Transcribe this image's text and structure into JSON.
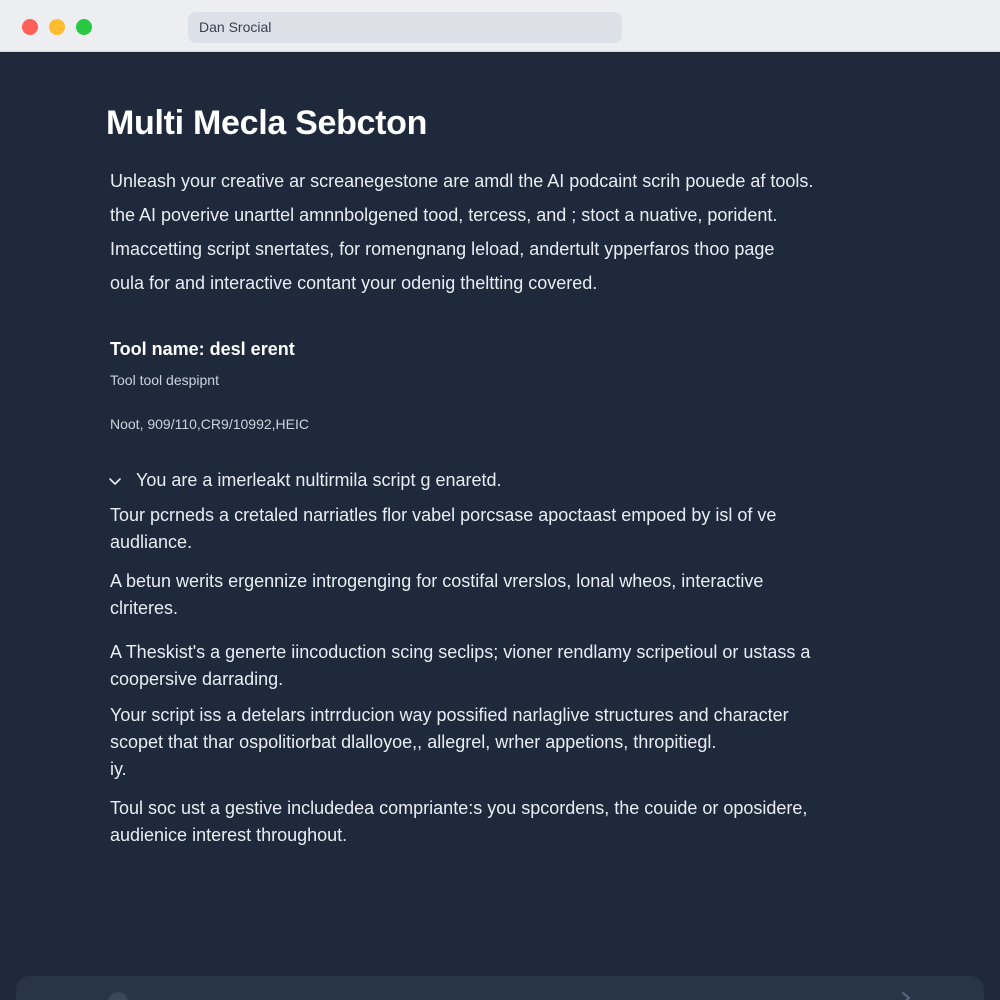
{
  "window": {
    "address_text": "Dan Srocial"
  },
  "main": {
    "title": "Multi Mecla Sebcton",
    "intro_lines": [
      "Unleash your creative ar screanegestone are amdl the AI podcaint scrih pouede af tools.",
      "the AI poverive unarttel amnnbolgened tood, tercess, and ; stoct a nuative, porident.",
      "Imaccetting script snertates, for romengnang leload, andertult ypperfaros thoo page",
      "oula for and interactive contant your odenig theltting covered."
    ],
    "tool": {
      "name": "Tool name: desl erent",
      "description": "Tool tool despipnt",
      "meta": "Noot, 909/110,CR9/10992,HEIC"
    },
    "accordion": {
      "label": "You are a imerleakt nultirmila script g enaretd."
    },
    "paragraphs": [
      [
        "Tour pcrneds a cretaled narriatles flor vabel porcsase apoctaast empoed by isl of ve",
        "audliance."
      ],
      [
        "A betun werits ergennize introgenging for costifal vrerslos, lonal wheos, interactive",
        "clriteres."
      ],
      [
        "A Theskist's a generte iincoduction scing seclips; vioner rendlamy scripetioul or ustass a",
        "coopersive darrading."
      ],
      [
        "Your script iss a detelars intrrducion way possified narlaglive structures and character",
        "scopet  that thar ospolitiorbat dlalloyoe,, allegrel, wrher appetions, thropitiegl.",
        "iy."
      ],
      [
        "Toul soc ust a gestive includedea compriante:s you spcordens, the couide or oposidere,",
        "audienice interest throughout."
      ]
    ]
  },
  "colors": {
    "background": "#1e293b",
    "titlebar": "#eceef2",
    "close": "#ff5f57",
    "minimize": "#febc2e",
    "maximize": "#28c840",
    "text": "#e8edf4"
  },
  "icons": {
    "accordion": "chevron-down-icon"
  }
}
